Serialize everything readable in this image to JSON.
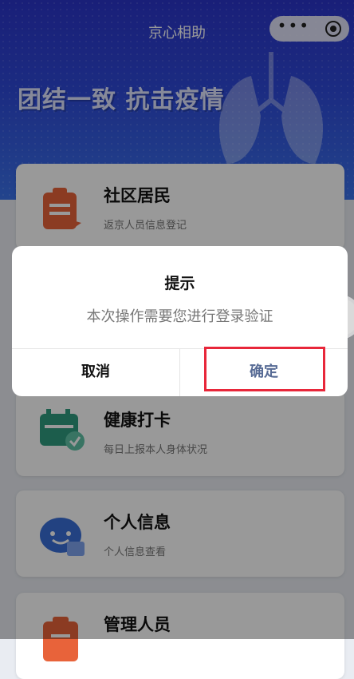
{
  "navbar": {
    "title": "京心相助"
  },
  "hero": {
    "slogan": "团结一致 抗击疫情"
  },
  "cards": [
    {
      "title": "社区居民",
      "subtitle": "返京人员信息登记",
      "icon": "clipboard-icon",
      "color": "#e8633a"
    },
    {
      "title": "健康打卡",
      "subtitle": "每日上报本人身体状况",
      "icon": "calendar-check-icon",
      "color": "#2f9b7f"
    },
    {
      "title": "个人信息",
      "subtitle": "个人信息查看",
      "icon": "chat-bubble-icon",
      "color": "#3a6fd8"
    },
    {
      "title": "管理人员",
      "subtitle": "",
      "icon": "id-badge-icon",
      "color": "#e8633a"
    }
  ],
  "dialog": {
    "title": "提示",
    "message": "本次操作需要您进行登录验证",
    "cancel_label": "取消",
    "confirm_label": "确定"
  },
  "colors": {
    "hero": "#2e49d8",
    "highlight": "#e8273a",
    "confirm": "#576b95"
  }
}
